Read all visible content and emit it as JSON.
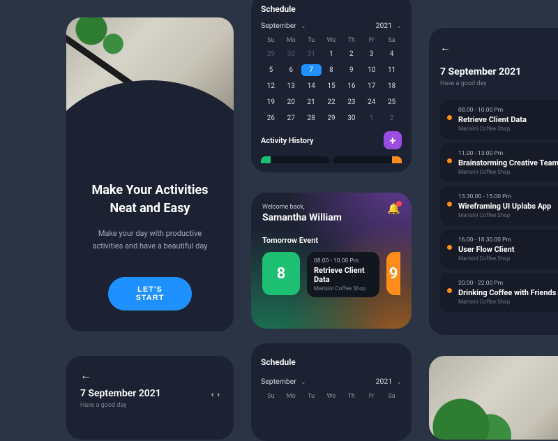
{
  "colors": {
    "accent": "#1e90ff",
    "green": "#1dbf73",
    "orange": "#ff8c1a",
    "purple": "#9b4de0",
    "card": "#1d2232",
    "bg": "#2a3444"
  },
  "onboarding": {
    "title_line1": "Make Your Activities",
    "title_line2": "Neat and Easy",
    "subtitle": "Make your day with productive activities and have a beautiful day",
    "cta": "LET'S START"
  },
  "schedule": {
    "title": "Schedule",
    "month": "September",
    "year": "2021",
    "dow": [
      "Su",
      "Mo",
      "Tu",
      "We",
      "Th",
      "Fr",
      "Sa"
    ],
    "days": [
      {
        "n": "29",
        "other": true
      },
      {
        "n": "30",
        "other": true
      },
      {
        "n": "31",
        "other": true
      },
      {
        "n": "1"
      },
      {
        "n": "2"
      },
      {
        "n": "3"
      },
      {
        "n": "4"
      },
      {
        "n": "5"
      },
      {
        "n": "6"
      },
      {
        "n": "7",
        "selected": true
      },
      {
        "n": "8"
      },
      {
        "n": "9"
      },
      {
        "n": "10"
      },
      {
        "n": "11"
      },
      {
        "n": "12"
      },
      {
        "n": "13"
      },
      {
        "n": "14"
      },
      {
        "n": "15"
      },
      {
        "n": "16"
      },
      {
        "n": "17"
      },
      {
        "n": "18"
      },
      {
        "n": "19"
      },
      {
        "n": "20"
      },
      {
        "n": "21"
      },
      {
        "n": "22"
      },
      {
        "n": "23"
      },
      {
        "n": "24"
      },
      {
        "n": "25"
      },
      {
        "n": "26"
      },
      {
        "n": "27"
      },
      {
        "n": "28"
      },
      {
        "n": "29"
      },
      {
        "n": "30"
      },
      {
        "n": "1",
        "other": true
      },
      {
        "n": "2",
        "other": true
      }
    ],
    "activity_label": "Activity History"
  },
  "home": {
    "welcome": "Welcome back,",
    "name": "Samantha William",
    "section": "Tomorrow Event",
    "events": [
      {
        "date": "8",
        "color": "green",
        "time": "08.00 - 10.00 Pm",
        "title": "Retrieve Client Data",
        "location": "Marisini Coffee Shop"
      },
      {
        "date": "9",
        "color": "orange"
      }
    ]
  },
  "day": {
    "date": "7 September 2021",
    "subtitle": "Have a good day",
    "events": [
      {
        "time": "08.00 - 10.00 Pm",
        "title": "Retrieve Client Data",
        "location": "Marisini Coffee Shop"
      },
      {
        "time": "11.00 - 13.00 Pm",
        "title": "Brainstorming Creative Team",
        "location": "Marisini Coffee Shop"
      },
      {
        "time": "13.30.00 - 15.00 Pm",
        "title": "Wireframing UI Uplabs App",
        "location": "Marisini Coffee Shop"
      },
      {
        "time": "16.00 - 18.30.00 Pm",
        "title": "User Flow Client",
        "location": "Marisini Coffee Shop"
      },
      {
        "time": "20.00 - 22.00 Pm",
        "title": "Drinking Coffee with Friends",
        "location": "Marisini Coffee Shop"
      }
    ]
  }
}
